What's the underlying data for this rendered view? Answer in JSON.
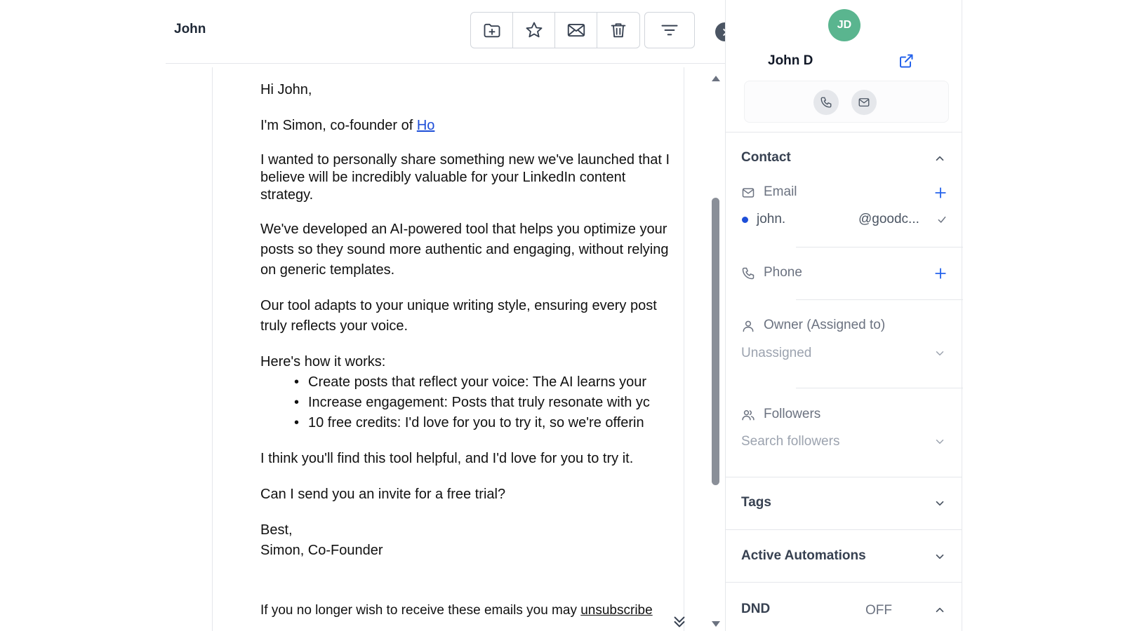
{
  "header": {
    "sender_name": "John",
    "toolbar": {
      "move": "folder-plus-icon",
      "star": "star-icon",
      "mail": "envelope-icon",
      "delete": "trash-icon",
      "filter": "filter-lines-icon"
    }
  },
  "email": {
    "greeting": "Hi John,",
    "intro_prefix": "I'm Simon, co-founder of ",
    "intro_link": "Ho",
    "para1": "I wanted to personally share something new we've launched that I believe will be incredibly valuable for your LinkedIn content strategy.",
    "para2": "We've developed an AI-powered tool that helps you optimize your posts so they sound more authentic and engaging, without relying on generic templates.",
    "para3": "Our tool adapts to your unique writing style, ensuring every post truly reflects your voice.",
    "how_heading": "Here's how it works:",
    "bullets": [
      "Create posts that reflect your voice: The AI learns your",
      "Increase engagement: Posts that truly resonate with yc",
      "10 free credits: I'd love for you to try it, so we're offerin"
    ],
    "para4": "I think you'll find this tool helpful, and I'd love for you to try it.",
    "para5": "Can I send you an invite for a free trial?",
    "signoff": "Best,",
    "signature": "Simon, Co-Founder",
    "unsub_prefix": "If you no longer wish to receive these emails you may ",
    "unsub_link": "unsubscribe"
  },
  "contact": {
    "initials": "JD",
    "avatar_color": "#5ab58f",
    "name": "John D",
    "section_title": "Contact",
    "email_label": "Email",
    "email_user": "john.",
    "email_domain": "@goodc...",
    "phone_label": "Phone",
    "owner_label": "Owner (Assigned to)",
    "owner_value": "Unassigned",
    "followers_label": "Followers",
    "followers_placeholder": "Search followers"
  },
  "sections": {
    "tags": "Tags",
    "automations": "Active Automations",
    "dnd": "DND",
    "dnd_status": "OFF"
  },
  "colors": {
    "link": "#1d4ed8",
    "accent": "#2563eb"
  }
}
